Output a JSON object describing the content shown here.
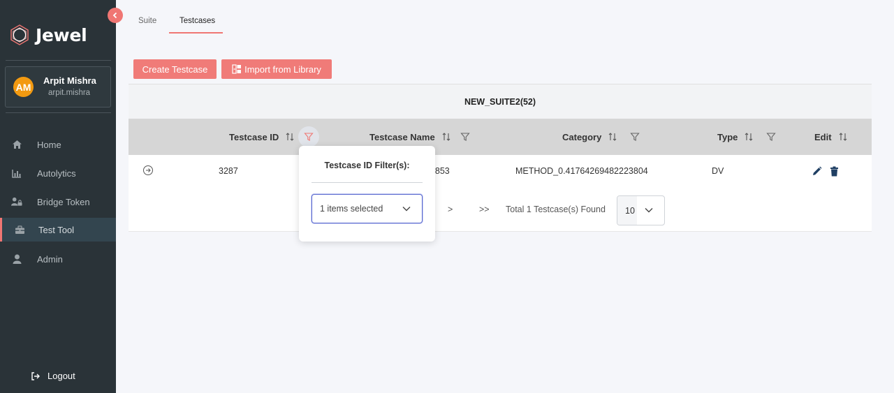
{
  "app": {
    "name": "Jewel"
  },
  "user": {
    "initials": "AM",
    "name": "Arpit Mishra",
    "username": "arpit.mishra"
  },
  "nav": [
    {
      "label": "Home",
      "icon": "home-icon"
    },
    {
      "label": "Autolytics",
      "icon": "bar-chart-icon"
    },
    {
      "label": "Bridge Token",
      "icon": "users-lock-icon"
    },
    {
      "label": "Test Tool",
      "icon": "toolbox-icon",
      "active": true
    },
    {
      "label": "Admin",
      "icon": "user-icon"
    }
  ],
  "logout_label": "Logout",
  "tabs": [
    {
      "label": "Suite"
    },
    {
      "label": "Testcases",
      "active": true
    }
  ],
  "buttons": {
    "create": "Create Testcase",
    "import": "Import from Library"
  },
  "table": {
    "suite_title": "NEW_SUITE2(52)",
    "headers": [
      "Testcase ID",
      "Testcase Name",
      "Category",
      "Type",
      "Edit"
    ],
    "rows": [
      {
        "id": "3287",
        "name": "42853",
        "category": "METHOD_0.41764269482223804",
        "type": "DV"
      }
    ]
  },
  "pagination": {
    "next": ">",
    "last": ">>",
    "summary": "Total 1 Testcase(s) Found",
    "page_size": "10"
  },
  "filter_popover": {
    "title": "Testcase ID Filter(s):",
    "selected": "1 items selected"
  },
  "colors": {
    "accent": "#f07673",
    "sidebar": "#2a3338",
    "avatar": "#f39a11"
  }
}
